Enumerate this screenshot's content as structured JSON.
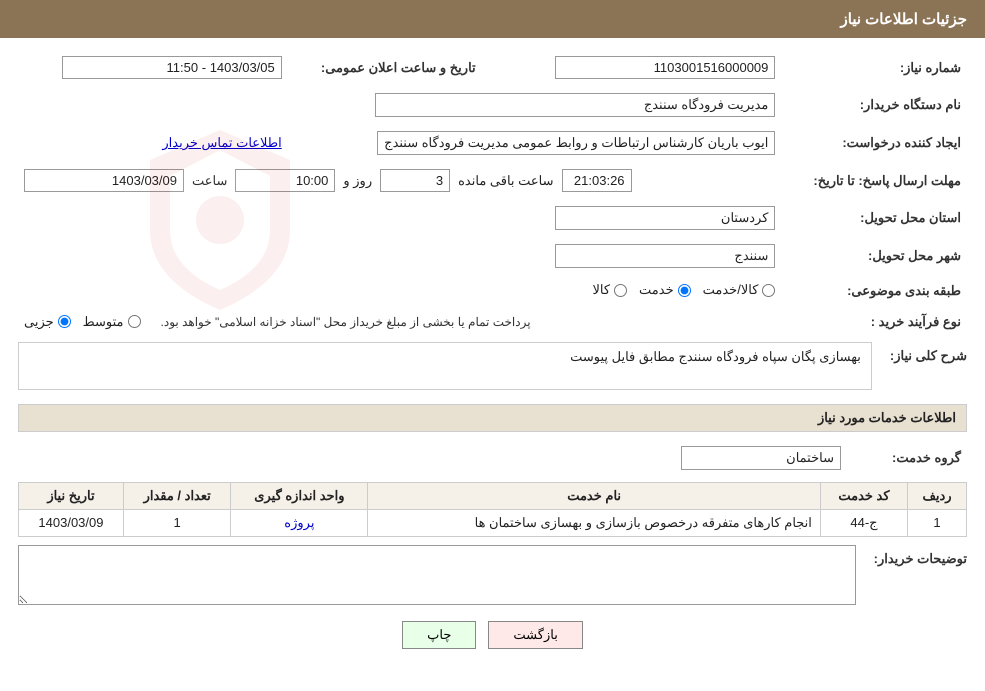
{
  "header": {
    "title": "جزئیات اطلاعات نیاز"
  },
  "fields": {
    "need_number_label": "شماره نیاز:",
    "need_number_value": "1103001516000009",
    "announce_date_label": "تاریخ و ساعت اعلان عمومی:",
    "announce_date_value": "1403/03/05 - 11:50",
    "buyer_org_label": "نام دستگاه خریدار:",
    "buyer_org_value": "مدیریت فرودگاه سنندج",
    "creator_label": "ایجاد کننده درخواست:",
    "creator_value": "ایوب باریان کارشناس ارتباطات و روابط عمومی مدیریت فرودگاه سنندج",
    "creator_link": "اطلاعات تماس خریدار",
    "response_deadline_label": "مهلت ارسال پاسخ: تا تاریخ:",
    "response_date": "1403/03/09",
    "response_time_label": "ساعت",
    "response_time": "10:00",
    "response_day_label": "روز و",
    "response_days": "3",
    "response_remaining_label": "ساعت باقی مانده",
    "response_remaining": "21:03:26",
    "province_label": "استان محل تحویل:",
    "province_value": "کردستان",
    "city_label": "شهر محل تحویل:",
    "city_value": "سنندج",
    "category_label": "طبقه بندی موضوعی:",
    "category_options": [
      "کالا",
      "خدمت",
      "کالا/خدمت"
    ],
    "category_selected": "خدمت",
    "purchase_type_label": "نوع فرآیند خرید :",
    "purchase_type_options": [
      "جزیی",
      "متوسط"
    ],
    "purchase_type_note": "پرداخت تمام یا بخشی از مبلغ خریداز محل \"اسناد خزانه اسلامی\" خواهد بود.",
    "description_label": "شرح کلی نیاز:",
    "description_value": "بهسازی پگان سپاه فرودگاه سنندج مطابق فایل پیوست",
    "service_info_label": "اطلاعات خدمات مورد نیاز",
    "service_group_label": "گروه خدمت:",
    "service_group_value": "ساختمان",
    "table": {
      "headers": [
        "ردیف",
        "کد خدمت",
        "نام خدمت",
        "واحد اندازه گیری",
        "تعداد / مقدار",
        "تاریخ نیاز"
      ],
      "rows": [
        {
          "row": "1",
          "code": "ج-44",
          "name": "انجام کارهای متفرقه درخصوص بازسازی و بهسازی ساختمان ها",
          "unit": "پروژه",
          "qty": "1",
          "date": "1403/03/09"
        }
      ]
    },
    "buyer_notes_label": "توضیحات خریدار:",
    "buyer_notes_value": ""
  },
  "buttons": {
    "print": "چاپ",
    "back": "بازگشت"
  }
}
